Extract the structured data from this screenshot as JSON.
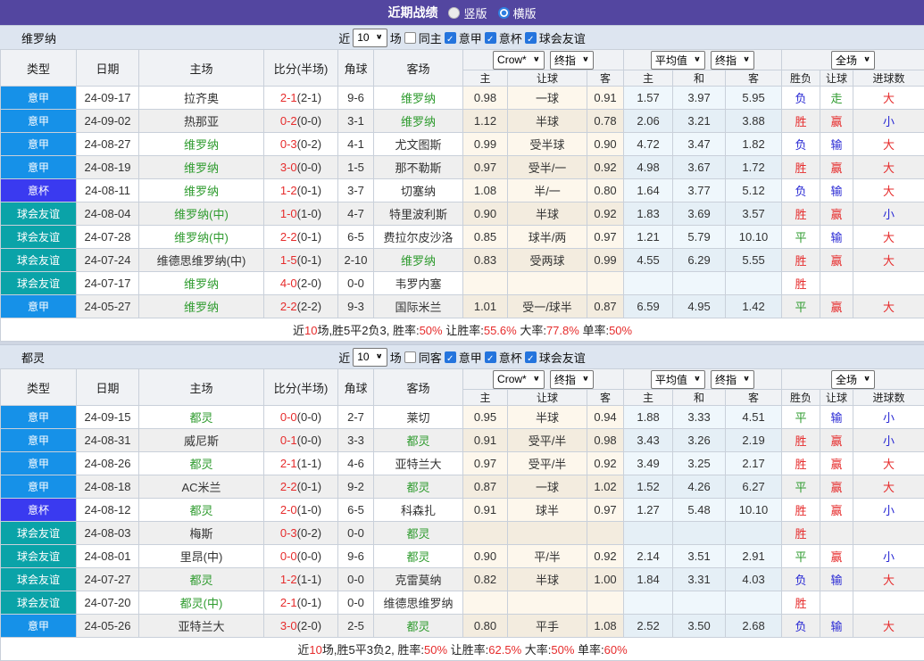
{
  "title": {
    "heading": "近期战绩",
    "view_options": [
      {
        "label": "竖版",
        "selected": false
      },
      {
        "label": "横版",
        "selected": true
      }
    ]
  },
  "columns": {
    "main": [
      "类型",
      "日期",
      "主场",
      "比分(半场)",
      "角球",
      "客场"
    ],
    "group1_selects": [
      "Crow*",
      "终指"
    ],
    "group2_selects": [
      "平均值",
      "终指"
    ],
    "group3_selects": [
      "全场"
    ],
    "sub": [
      "主",
      "让球",
      "客",
      "主",
      "和",
      "客",
      "胜负",
      "让球",
      "进球数"
    ]
  },
  "badge_colors": {
    "意甲": "#1691e8",
    "意杯": "#3a3af0",
    "球会友谊": "#0aa3a8"
  },
  "result_colors": {
    "胜": "#e62c2c",
    "赢": "#e62c2c",
    "大": "#e62c2c",
    "平": "#2e9b2e",
    "走": "#2e9b2e",
    "负": "#2929d4",
    "输": "#2929d4",
    "小": "#2929d4"
  },
  "teams": [
    {
      "name": "维罗纳",
      "filter": {
        "recent_label": "近",
        "count": "10",
        "games_label": "场",
        "same_label": "同主",
        "same_checked": false,
        "comps": [
          {
            "label": "意甲",
            "checked": true
          },
          {
            "label": "意杯",
            "checked": true
          },
          {
            "label": "球会友谊",
            "checked": true
          }
        ]
      },
      "rows": [
        {
          "type": "意甲",
          "date": "24-09-17",
          "home": "拉齐奥",
          "homeFocal": false,
          "ft": "2-1",
          "ht": "(2-1)",
          "corner": "9-6",
          "away": "维罗纳",
          "awayFocal": true,
          "o1": "0.98",
          "hc": "一球",
          "o2": "0.91",
          "m1": "1.57",
          "m2": "3.97",
          "m3": "5.95",
          "r1": "负",
          "r2": "走",
          "r3": "大"
        },
        {
          "type": "意甲",
          "date": "24-09-02",
          "home": "热那亚",
          "homeFocal": false,
          "ft": "0-2",
          "ht": "(0-0)",
          "corner": "3-1",
          "away": "维罗纳",
          "awayFocal": true,
          "o1": "1.12",
          "hc": "半球",
          "o2": "0.78",
          "m1": "2.06",
          "m2": "3.21",
          "m3": "3.88",
          "r1": "胜",
          "r2": "赢",
          "r3": "小"
        },
        {
          "type": "意甲",
          "date": "24-08-27",
          "home": "维罗纳",
          "homeFocal": true,
          "ft": "0-3",
          "ht": "(0-2)",
          "corner": "4-1",
          "away": "尤文图斯",
          "awayFocal": false,
          "o1": "0.99",
          "hc": "受半球",
          "o2": "0.90",
          "m1": "4.72",
          "m2": "3.47",
          "m3": "1.82",
          "r1": "负",
          "r2": "输",
          "r3": "大"
        },
        {
          "type": "意甲",
          "date": "24-08-19",
          "home": "维罗纳",
          "homeFocal": true,
          "ft": "3-0",
          "ht": "(0-0)",
          "corner": "1-5",
          "away": "那不勒斯",
          "awayFocal": false,
          "o1": "0.97",
          "hc": "受半/一",
          "o2": "0.92",
          "m1": "4.98",
          "m2": "3.67",
          "m3": "1.72",
          "r1": "胜",
          "r2": "赢",
          "r3": "大"
        },
        {
          "type": "意杯",
          "date": "24-08-11",
          "home": "维罗纳",
          "homeFocal": true,
          "ft": "1-2",
          "ht": "(0-1)",
          "corner": "3-7",
          "away": "切塞纳",
          "awayFocal": false,
          "o1": "1.08",
          "hc": "半/一",
          "o2": "0.80",
          "m1": "1.64",
          "m2": "3.77",
          "m3": "5.12",
          "r1": "负",
          "r2": "输",
          "r3": "大"
        },
        {
          "type": "球会友谊",
          "date": "24-08-04",
          "home": "维罗纳(中)",
          "homeFocal": true,
          "ft": "1-0",
          "ht": "(1-0)",
          "corner": "4-7",
          "away": "特里波利斯",
          "awayFocal": false,
          "o1": "0.90",
          "hc": "半球",
          "o2": "0.92",
          "m1": "1.83",
          "m2": "3.69",
          "m3": "3.57",
          "r1": "胜",
          "r2": "赢",
          "r3": "小"
        },
        {
          "type": "球会友谊",
          "date": "24-07-28",
          "home": "维罗纳(中)",
          "homeFocal": true,
          "ft": "2-2",
          "ht": "(0-1)",
          "corner": "6-5",
          "away": "费拉尔皮沙洛",
          "awayFocal": false,
          "o1": "0.85",
          "hc": "球半/两",
          "o2": "0.97",
          "m1": "1.21",
          "m2": "5.79",
          "m3": "10.10",
          "r1": "平",
          "r2": "输",
          "r3": "大"
        },
        {
          "type": "球会友谊",
          "date": "24-07-24",
          "home": "维德思维罗纳(中)",
          "homeFocal": false,
          "ft": "1-5",
          "ht": "(0-1)",
          "corner": "2-10",
          "away": "维罗纳",
          "awayFocal": true,
          "o1": "0.83",
          "hc": "受两球",
          "o2": "0.99",
          "m1": "4.55",
          "m2": "6.29",
          "m3": "5.55",
          "r1": "胜",
          "r2": "赢",
          "r3": "大"
        },
        {
          "type": "球会友谊",
          "date": "24-07-17",
          "home": "维罗纳",
          "homeFocal": true,
          "ft": "4-0",
          "ht": "(2-0)",
          "corner": "0-0",
          "away": "韦罗内塞",
          "awayFocal": false,
          "o1": "",
          "hc": "",
          "o2": "",
          "m1": "",
          "m2": "",
          "m3": "",
          "r1": "胜",
          "r2": "",
          "r3": ""
        },
        {
          "type": "意甲",
          "date": "24-05-27",
          "home": "维罗纳",
          "homeFocal": true,
          "ft": "2-2",
          "ht": "(2-2)",
          "corner": "9-3",
          "away": "国际米兰",
          "awayFocal": false,
          "o1": "1.01",
          "hc": "受一/球半",
          "o2": "0.87",
          "m1": "6.59",
          "m2": "4.95",
          "m3": "1.42",
          "r1": "平",
          "r2": "赢",
          "r3": "大"
        }
      ],
      "summary": [
        {
          "t": "近"
        },
        {
          "t": "10",
          "hl": true
        },
        {
          "t": "场,胜5平2负3, 胜率:"
        },
        {
          "t": "50%",
          "hl": true
        },
        {
          "t": " 让胜率:"
        },
        {
          "t": "55.6%",
          "hl": true
        },
        {
          "t": " 大率:"
        },
        {
          "t": "77.8%",
          "hl": true
        },
        {
          "t": " 单率:"
        },
        {
          "t": "50%",
          "hl": true
        }
      ]
    },
    {
      "name": "都灵",
      "filter": {
        "recent_label": "近",
        "count": "10",
        "games_label": "场",
        "same_label": "同客",
        "same_checked": false,
        "comps": [
          {
            "label": "意甲",
            "checked": true
          },
          {
            "label": "意杯",
            "checked": true
          },
          {
            "label": "球会友谊",
            "checked": true
          }
        ]
      },
      "rows": [
        {
          "type": "意甲",
          "date": "24-09-15",
          "home": "都灵",
          "homeFocal": true,
          "ft": "0-0",
          "ht": "(0-0)",
          "corner": "2-7",
          "away": "莱切",
          "awayFocal": false,
          "o1": "0.95",
          "hc": "半球",
          "o2": "0.94",
          "m1": "1.88",
          "m2": "3.33",
          "m3": "4.51",
          "r1": "平",
          "r2": "输",
          "r3": "小"
        },
        {
          "type": "意甲",
          "date": "24-08-31",
          "home": "威尼斯",
          "homeFocal": false,
          "ft": "0-1",
          "ht": "(0-0)",
          "corner": "3-3",
          "away": "都灵",
          "awayFocal": true,
          "o1": "0.91",
          "hc": "受平/半",
          "o2": "0.98",
          "m1": "3.43",
          "m2": "3.26",
          "m3": "2.19",
          "r1": "胜",
          "r2": "赢",
          "r3": "小"
        },
        {
          "type": "意甲",
          "date": "24-08-26",
          "home": "都灵",
          "homeFocal": true,
          "ft": "2-1",
          "ht": "(1-1)",
          "corner": "4-6",
          "away": "亚特兰大",
          "awayFocal": false,
          "o1": "0.97",
          "hc": "受平/半",
          "o2": "0.92",
          "m1": "3.49",
          "m2": "3.25",
          "m3": "2.17",
          "r1": "胜",
          "r2": "赢",
          "r3": "大"
        },
        {
          "type": "意甲",
          "date": "24-08-18",
          "home": "AC米兰",
          "homeFocal": false,
          "ft": "2-2",
          "ht": "(0-1)",
          "corner": "9-2",
          "away": "都灵",
          "awayFocal": true,
          "o1": "0.87",
          "hc": "一球",
          "o2": "1.02",
          "m1": "1.52",
          "m2": "4.26",
          "m3": "6.27",
          "r1": "平",
          "r2": "赢",
          "r3": "大"
        },
        {
          "type": "意杯",
          "date": "24-08-12",
          "home": "都灵",
          "homeFocal": true,
          "ft": "2-0",
          "ht": "(1-0)",
          "corner": "6-5",
          "away": "科森扎",
          "awayFocal": false,
          "o1": "0.91",
          "hc": "球半",
          "o2": "0.97",
          "m1": "1.27",
          "m2": "5.48",
          "m3": "10.10",
          "r1": "胜",
          "r2": "赢",
          "r3": "小"
        },
        {
          "type": "球会友谊",
          "date": "24-08-03",
          "home": "梅斯",
          "homeFocal": false,
          "ft": "0-3",
          "ht": "(0-2)",
          "corner": "0-0",
          "away": "都灵",
          "awayFocal": true,
          "o1": "",
          "hc": "",
          "o2": "",
          "m1": "",
          "m2": "",
          "m3": "",
          "r1": "胜",
          "r2": "",
          "r3": ""
        },
        {
          "type": "球会友谊",
          "date": "24-08-01",
          "home": "里昂(中)",
          "homeFocal": false,
          "ft": "0-0",
          "ht": "(0-0)",
          "corner": "9-6",
          "away": "都灵",
          "awayFocal": true,
          "o1": "0.90",
          "hc": "平/半",
          "o2": "0.92",
          "m1": "2.14",
          "m2": "3.51",
          "m3": "2.91",
          "r1": "平",
          "r2": "赢",
          "r3": "小"
        },
        {
          "type": "球会友谊",
          "date": "24-07-27",
          "home": "都灵",
          "homeFocal": true,
          "ft": "1-2",
          "ht": "(1-1)",
          "corner": "0-0",
          "away": "克雷莫纳",
          "awayFocal": false,
          "o1": "0.82",
          "hc": "半球",
          "o2": "1.00",
          "m1": "1.84",
          "m2": "3.31",
          "m3": "4.03",
          "r1": "负",
          "r2": "输",
          "r3": "大"
        },
        {
          "type": "球会友谊",
          "date": "24-07-20",
          "home": "都灵(中)",
          "homeFocal": true,
          "ft": "2-1",
          "ht": "(0-1)",
          "corner": "0-0",
          "away": "维德思维罗纳",
          "awayFocal": false,
          "o1": "",
          "hc": "",
          "o2": "",
          "m1": "",
          "m2": "",
          "m3": "",
          "r1": "胜",
          "r2": "",
          "r3": ""
        },
        {
          "type": "意甲",
          "date": "24-05-26",
          "home": "亚特兰大",
          "homeFocal": false,
          "ft": "3-0",
          "ht": "(2-0)",
          "corner": "2-5",
          "away": "都灵",
          "awayFocal": true,
          "o1": "0.80",
          "hc": "平手",
          "o2": "1.08",
          "m1": "2.52",
          "m2": "3.50",
          "m3": "2.68",
          "r1": "负",
          "r2": "输",
          "r3": "大"
        }
      ],
      "summary": [
        {
          "t": "近"
        },
        {
          "t": "10",
          "hl": true
        },
        {
          "t": "场,胜5平3负2, 胜率:"
        },
        {
          "t": "50%",
          "hl": true
        },
        {
          "t": " 让胜率:"
        },
        {
          "t": "62.5%",
          "hl": true
        },
        {
          "t": " 大率:"
        },
        {
          "t": "50%",
          "hl": true
        },
        {
          "t": " 单率:"
        },
        {
          "t": "60%",
          "hl": true
        }
      ]
    }
  ]
}
